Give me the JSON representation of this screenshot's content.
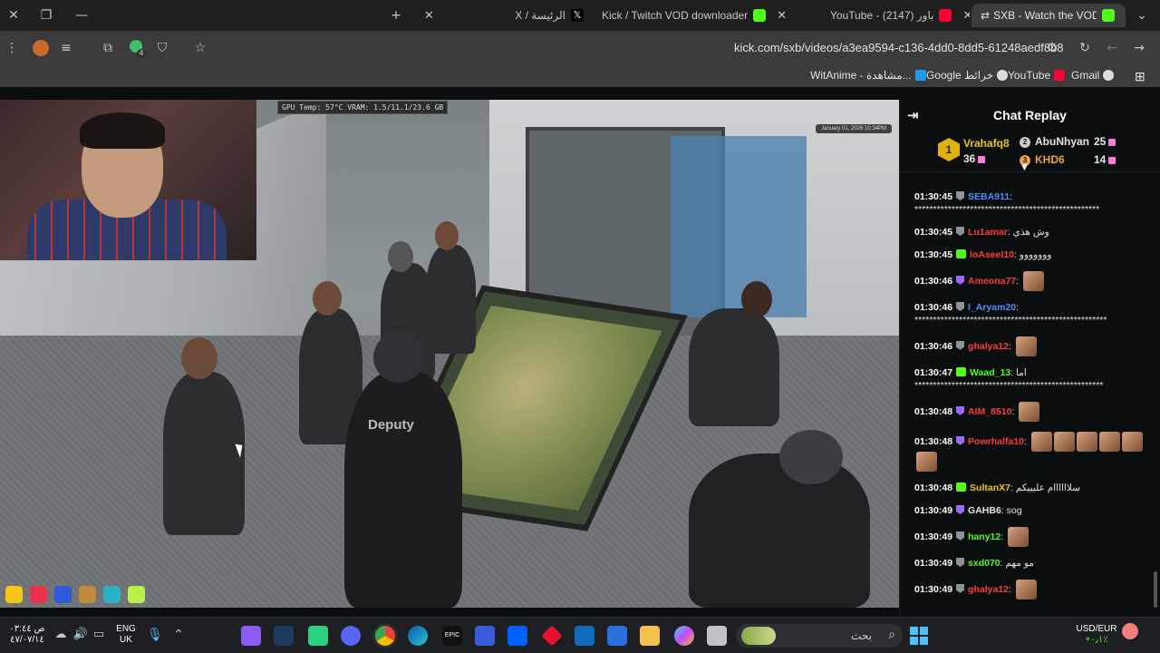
{
  "browser": {
    "tabs": [
      {
        "label": "الرئيسة / X",
        "icon": "x-icon",
        "active": false
      },
      {
        "label": "Kick / Twitch VOD downloader",
        "icon": "kick-downloader-icon",
        "active": false
      },
      {
        "label": "YouTube - باور (2147)",
        "icon": "youtube-icon",
        "active": false
      },
      {
        "label": "SXB - Watch the VOD on Kick",
        "icon": "kick-icon",
        "active": true
      }
    ],
    "url": "kick.com/sxb/videos/a3ea9594-c136-4dd0-8dd5-61248aedf8b8",
    "bookmarks": [
      {
        "label": "WitAnime - مشاهدة..."
      },
      {
        "label": "Google خرائط"
      },
      {
        "label": "YouTube"
      },
      {
        "label": "Gmail"
      }
    ],
    "extension_badge": "4"
  },
  "video": {
    "gpu_overlay": "GPU Temp: 57°C  VRAM: 1.5/11.1/23.6 GB",
    "date_stamp": "January 01, 2026 10:34PM",
    "jacket_text": "Deputy"
  },
  "chat": {
    "title": "Chat Replay",
    "leaderboard": [
      {
        "rank": "1",
        "name": "Vrahafq8",
        "count": "36",
        "color": "#f0c419"
      },
      {
        "rank": "2",
        "name": "AbuNhyan",
        "count": "25",
        "color": "#e3e3e3"
      },
      {
        "rank": "3",
        "name": "KHD6",
        "count": "14",
        "color": "#e8a24a"
      }
    ],
    "messages": [
      {
        "time": "01:30:45",
        "user": "SEBA911",
        "color": "#4f8dff",
        "text": "**************************************************",
        "badge": "gray",
        "emotes": 0
      },
      {
        "time": "01:30:45",
        "user": "Lu1amar",
        "color": "#ff3b3b",
        "text": "وش هذي",
        "badge": "gray",
        "emotes": 0
      },
      {
        "time": "01:30:45",
        "user": "loAseel10",
        "color": "#ff3b3b",
        "text": "ووووووو",
        "badge": "green",
        "emotes": 0
      },
      {
        "time": "01:30:46",
        "user": "Ameona77",
        "color": "#ff3b3b",
        "text": "",
        "badge": "purple",
        "emotes": 1
      },
      {
        "time": "01:30:46",
        "user": "I_Aryam20",
        "color": "#4f8dff",
        "text": "****************************************************",
        "badge": "gray",
        "emotes": 0
      },
      {
        "time": "01:30:46",
        "user": "ghalya12",
        "color": "#ff3b3b",
        "text": "",
        "badge": "gray",
        "emotes": 1
      },
      {
        "time": "01:30:47",
        "user": "Waad_13",
        "color": "#53fc18",
        "text": "اما ***************************************************",
        "badge": "green",
        "emotes": 0
      },
      {
        "time": "01:30:48",
        "user": "AIM_8510",
        "color": "#ff3b3b",
        "text": "",
        "badge": "purple",
        "emotes": 1
      },
      {
        "time": "01:30:48",
        "user": "Powrhalfa10",
        "color": "#ff3b3b",
        "text": "",
        "badge": "purple",
        "emotes": 6
      },
      {
        "time": "01:30:48",
        "user": "SultanX7",
        "color": "#f0c419",
        "text": "سلاااااام عليييكم",
        "badge": "green",
        "emotes": 0
      },
      {
        "time": "01:30:49",
        "user": "GAHB6",
        "color": "#e3e3e3",
        "text": "sog",
        "badge": "purple",
        "emotes": 0
      },
      {
        "time": "01:30:49",
        "user": "hany12",
        "color": "#53fc18",
        "text": "",
        "badge": "gray",
        "emotes": 1
      },
      {
        "time": "01:30:49",
        "user": "sxd070",
        "color": "#53fc18",
        "text": "مو مهم",
        "badge": "gray",
        "emotes": 0
      },
      {
        "time": "01:30:49",
        "user": "ghalya12",
        "color": "#ff3b3b",
        "text": "",
        "badge": "gray",
        "emotes": 1
      }
    ]
  },
  "taskbar": {
    "clock_time": "ص ٠٣:٤٤",
    "clock_date": "٤٧/٠٧/١٤",
    "lang_top": "ENG",
    "lang_bottom": "UK",
    "search_placeholder": "بحث",
    "currency": "USD/EUR",
    "currency_change": "+٠٫١٪"
  }
}
